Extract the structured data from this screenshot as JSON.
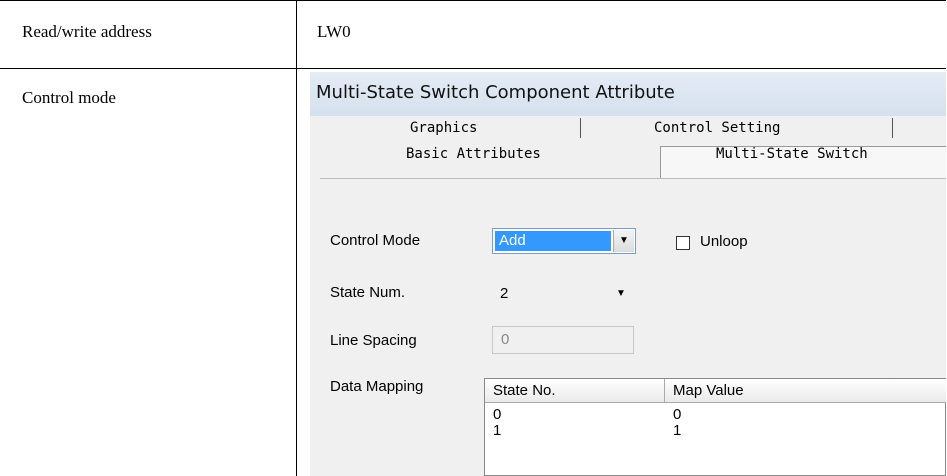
{
  "table": {
    "rows": [
      {
        "label": "Read/write address",
        "value": "LW0"
      },
      {
        "label": "Control mode"
      }
    ]
  },
  "dialog": {
    "title": "Multi-State Switch Component Attribute",
    "tabs_back": [
      "Graphics",
      "Control Setting"
    ],
    "tabs_front": [
      "Basic Attributes",
      "Multi-State Switch"
    ],
    "control_mode": {
      "label": "Control Mode",
      "value": "Add"
    },
    "unloop": {
      "label": "Unloop",
      "checked": false
    },
    "state_num": {
      "label": "State Num.",
      "value": "2"
    },
    "line_spacing": {
      "label": "Line Spacing",
      "value": "0"
    },
    "data_mapping": {
      "label": "Data Mapping",
      "columns": [
        "State No.",
        "Map Value"
      ],
      "rows": [
        [
          "0",
          "0"
        ],
        [
          "1",
          "1"
        ]
      ]
    }
  }
}
